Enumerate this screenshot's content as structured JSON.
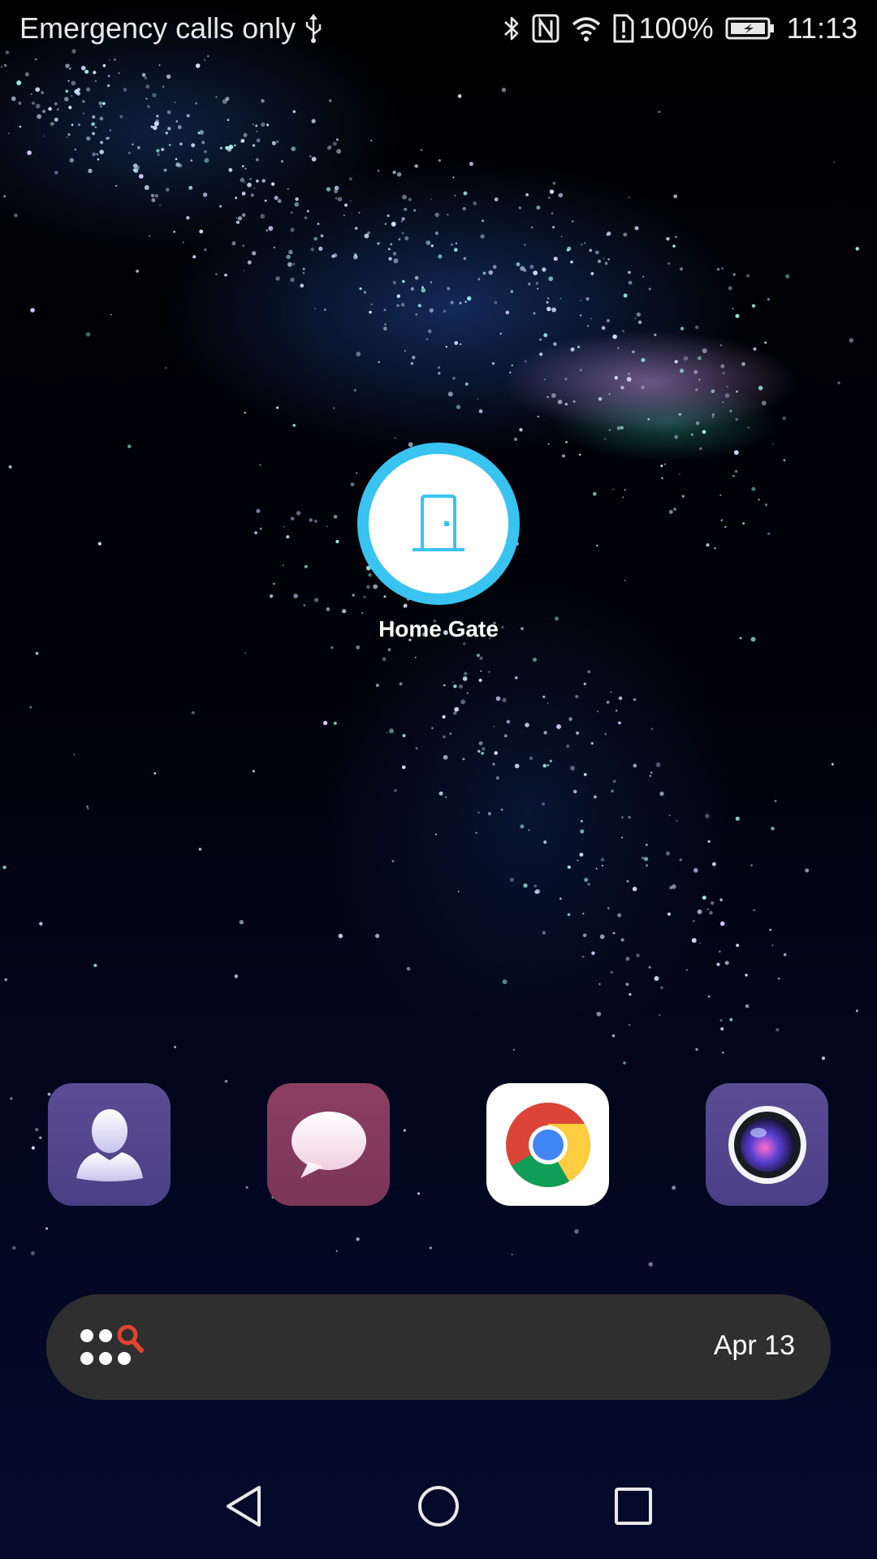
{
  "status_bar": {
    "carrier_text": "Emergency calls only",
    "battery_percent": "100%",
    "time": "11:13",
    "icons": [
      "usb-icon",
      "bluetooth-icon",
      "nfc-icon",
      "wifi-icon",
      "sim-alert-icon",
      "battery-charging-icon"
    ]
  },
  "home_screen": {
    "shortcut": {
      "label": "Home Gate",
      "icon": "door-icon",
      "accent_color": "#39c3f1"
    }
  },
  "dock": {
    "apps": [
      {
        "icon": "contacts-icon",
        "color": "#4f4289"
      },
      {
        "icon": "messages-icon",
        "color": "#81395b"
      },
      {
        "icon": "chrome-icon",
        "color": "#ffffff"
      },
      {
        "icon": "camera-icon",
        "color": "#4f4289"
      }
    ]
  },
  "search_bar": {
    "date": "Apr 13",
    "icon": "app-drawer-search-icon",
    "search_accent_color": "#e0452b"
  },
  "nav_bar": {
    "buttons": [
      "back-icon",
      "home-icon",
      "recents-icon"
    ]
  }
}
